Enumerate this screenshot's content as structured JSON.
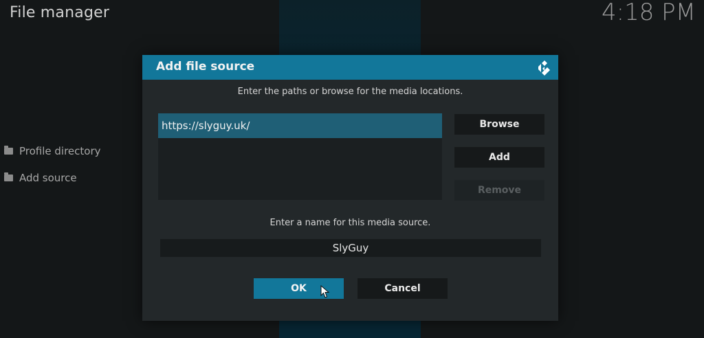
{
  "app": {
    "title": "File manager",
    "clock": "4:18 PM"
  },
  "sidebar": {
    "items": [
      {
        "label": "Profile directory",
        "icon": "folder-icon"
      },
      {
        "label": "Add source",
        "icon": "folder-icon"
      }
    ]
  },
  "dialog": {
    "title": "Add file source",
    "logo_icon": "kodi-logo-icon",
    "paths_instruction": "Enter the paths or browse for the media locations.",
    "paths": [
      "https://slyguy.uk/"
    ],
    "buttons": {
      "browse": "Browse",
      "add": "Add",
      "remove": "Remove"
    },
    "name_instruction": "Enter a name for this media source.",
    "name_value": "SlyGuy",
    "ok": "OK",
    "cancel": "Cancel"
  },
  "colors": {
    "accent": "#12779a",
    "selected_row": "#1f5f76",
    "dialog_bg": "#23282a",
    "background": "#141718"
  }
}
